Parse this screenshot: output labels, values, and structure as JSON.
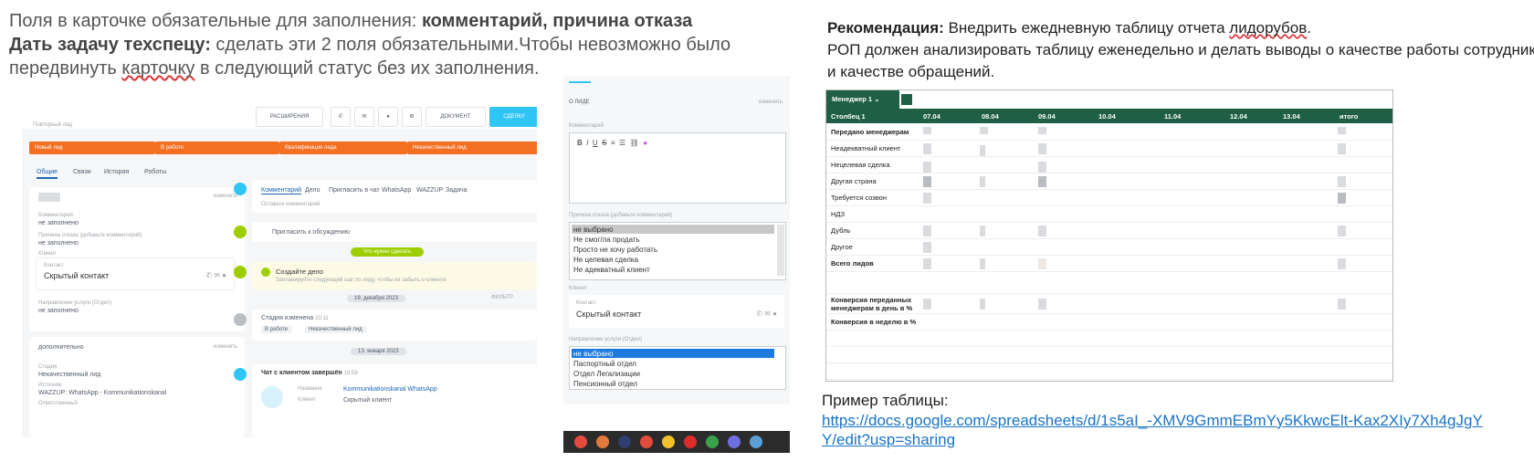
{
  "left_text": {
    "line1_prefix": "Поля в карточке обязательные для заполнения:",
    "line1_bold": "комментарий, причина отказа",
    "line2_bold": "Дать задачу техспецу:",
    "line2_rest": "сделать эти 2 поля обязательными.Чтобы невозможно было",
    "line3_a": "передвинуть",
    "line3_b": "карточку",
    "line3_c": "в следующий статус без их заполнения."
  },
  "crm": {
    "header_buttons": [
      "РАСШИРЕНИЯ",
      "ДОКУМЕНТ",
      "СДЕЛКУ"
    ],
    "title": "Повторный лид",
    "stages": [
      "Новый лид",
      "В работе",
      "Квалификация лида",
      "Некачественный лид"
    ],
    "tabs": [
      "Общие",
      "Связи",
      "История",
      "Роботы"
    ],
    "change": "изменить",
    "fields": {
      "comment_label": "Комментарий",
      "comment_value": "не заполнено",
      "reason_label": "Причина отказа (добавьте комментарий)",
      "reason_value": "не заполнено",
      "client_label": "Клиент",
      "contact_label": "Контакт",
      "contact_value": "Скрытый контакт",
      "direction_label": "Направление услуги (Отдел)",
      "direction_value": "не заполнено"
    },
    "extra_title": "дополнительно",
    "stage_label": "Стадия",
    "stage_value": "Некачественный лид",
    "source_label": "Источник",
    "source_value": "WAZZUP: WhatsApp - Kommunikationskanal",
    "responsible_label": "Ответственный",
    "timeline_tabs": [
      "Комментарий",
      "Дело",
      "Пригласить в чат",
      "WhatsApp",
      "WAZZUP",
      "Задача"
    ],
    "leave_comment": "Оставьте комментарий",
    "invite": "Пригласить к обсуждению",
    "what_todo": "Что нужно сделать",
    "create_task": "Создайте дело",
    "create_task_hint": "Запланируйте следующий шаг по лиду, чтобы не забыть о клиенте",
    "date1": "19. декабря 2023",
    "filter": "ФИЛЬТР",
    "stage_changed": "Стадия изменена",
    "stage_changed_time": "20:11",
    "stage_from": "В работе",
    "stage_to": "Некачественный лид",
    "date2": "13. января 2023",
    "chat_done": "Чат с клиентом завершён",
    "chat_time": "18:58",
    "chat_name_label": "Название",
    "chat_name_value": "Kommunikationskanal WhatsApp",
    "chat_client_label": "Клиент",
    "chat_client_value": "Скрытый клиент"
  },
  "form": {
    "about": "О ЛИДЕ",
    "change": "изменить",
    "comment_label": "Комментарий",
    "toolbar": [
      "B",
      "I",
      "U",
      "S"
    ],
    "reason_label": "Причина отказа (добавьте комментарий)",
    "reason_options": [
      "не выбрано",
      "Не смог/ла продать",
      "Просто не хочу работать",
      "Не целевая сделка",
      "Не адекватный клиент"
    ],
    "client_label": "Клиент",
    "contact_label": "Контакт",
    "contact_value": "Скрытый контакт",
    "direction_label": "Направление услуги (Отдел)",
    "direction_options": [
      "не выбрано",
      "Паспортный отдел",
      "Отдел Легализации",
      "Пенсионный отдел"
    ]
  },
  "right_text": {
    "rec_bold": "Рекомендация:",
    "rec_rest_a": "Внедрить ежедневную таблицу отчета",
    "rec_rest_b": "лидорубов",
    "rec_line2": "РОП должен анализировать таблицу еженедельно и делать выводы о качестве работы сотрудник",
    "rec_line3": "и качестве обращений."
  },
  "sheet": {
    "tab": "Менеджер 1",
    "headers": [
      "Столбец 1",
      "07.04",
      "08.04",
      "09.04",
      "10.04",
      "11.04",
      "12.04",
      "13.04",
      "итого"
    ],
    "rows": [
      "Передано менеджерам",
      "Неадекватный клиент",
      "Нецелевая сделка",
      "Другая страна",
      "Требуется созвон",
      "НДЗ",
      "Дубль",
      "Другое",
      "Всего лидов",
      "",
      "Конверсия переданных менеджерам в день в %",
      "Конверсия в неделю в %"
    ]
  },
  "example": {
    "label": "Пример таблицы:",
    "url_line1": "https://docs.google.com/spreadsheets/d/1s5aI_-XMV9GmmEBmYy5KkwcElt-Kax2XIy7Xh4gJgY",
    "url_line2": "Y/edit?usp=sharing"
  },
  "colors": {
    "stage_orange": "#f36f21",
    "sheet_header_green": "#1f5f46",
    "crm_blue": "#2fc6f6",
    "link_blue": "#1a73c7"
  }
}
